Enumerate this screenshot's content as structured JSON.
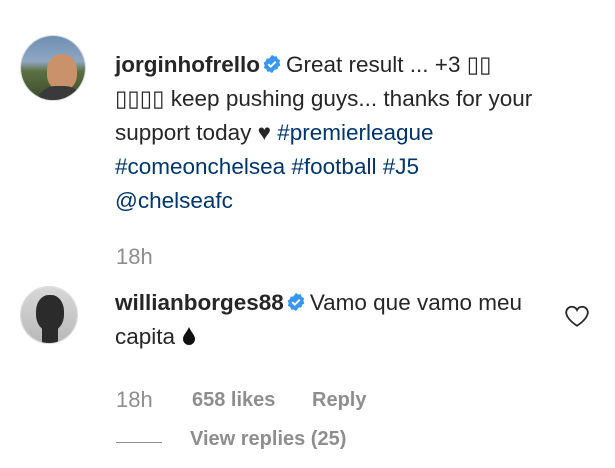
{
  "post": {
    "username": "jorginhofrello",
    "caption_part1": "Great result ... +3 ",
    "caption_boxes1": "▯▯",
    "caption_boxes2": "▯▯▯▯",
    "caption_part2": " keep pushing guys... thanks for your support today ",
    "caption_emoji": "♥",
    "hashtags": [
      "#premierleague",
      "#comeonchelsea",
      "#football",
      "#J5"
    ],
    "mention": "@chelseafc",
    "time": "18h"
  },
  "comment": {
    "username": "willianborges88",
    "text": "Vamo que vamo meu capita ",
    "emoji": "💧",
    "time": "18h",
    "likes": "658 likes",
    "reply": "Reply",
    "view_replies": "View replies (25)"
  },
  "colors": {
    "text": "#262626",
    "secondary": "#8e8e8e",
    "link": "#003569",
    "verified": "#3897f0"
  }
}
